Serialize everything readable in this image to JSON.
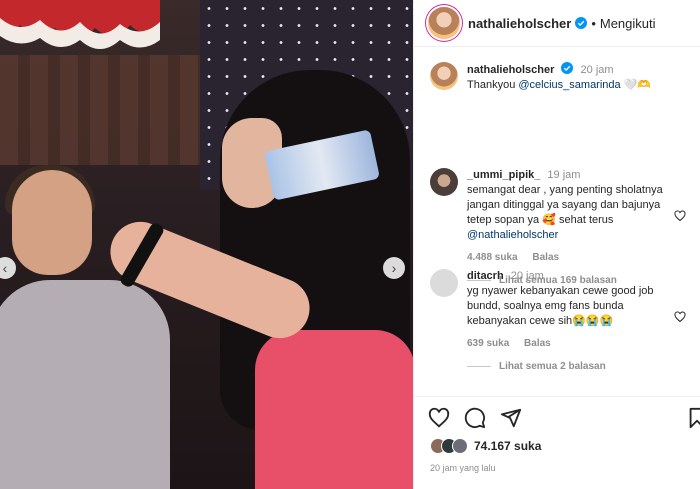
{
  "post": {
    "author": "nathalieholscher",
    "follow_label": "Mengikuti",
    "separator": "•"
  },
  "carousel": {
    "prev_icon": "chevron-left-icon",
    "next_icon": "chevron-right-icon"
  },
  "caption": {
    "username": "nathalieholscher",
    "time": "20 jam",
    "text": "Thankyou ",
    "mention": "@celcius_samarinda",
    "emoji": " 🤍🫶"
  },
  "comments": [
    {
      "username": "_ummi_pipik_",
      "time": "19 jam",
      "text": "semangat dear , yang penting sholatnya jangan ditinggal ya sayang dan bajunya tetep sopan ya 🥰 sehat terus ",
      "mention": "@nathalieholscher",
      "likes": "4.488 suka",
      "reply": "Balas",
      "view_replies": "Lihat semua 169 balasan"
    },
    {
      "username": "ditacrh",
      "time": "20 jam",
      "text": "yg nyawer kebanyakan cewe good job bundd, soalnya emg fans bunda kebanyakan cewe sih😭😭😭",
      "likes": "639 suka",
      "reply": "Balas",
      "view_replies": "Lihat semua 2 balasan"
    }
  ],
  "footer": {
    "likes": "74.167 suka",
    "timestamp": "20 jam yang lalu"
  },
  "colors": {
    "verified": "#0095f6",
    "link": "#00376b",
    "dress": "#e8506a"
  }
}
